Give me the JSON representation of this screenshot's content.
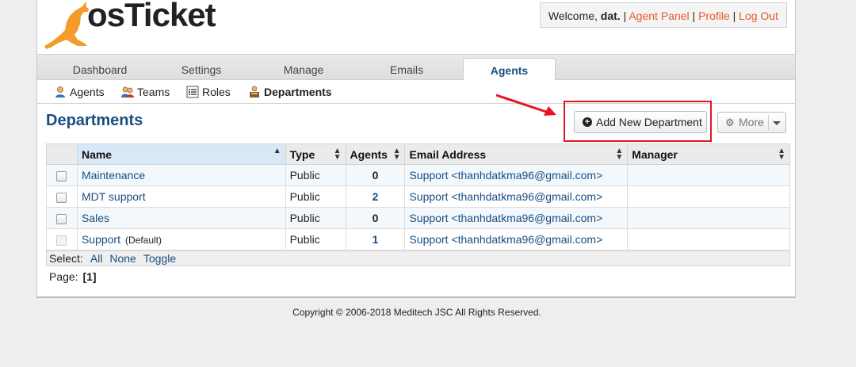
{
  "header": {
    "logo_text": "osTicket",
    "welcome": "Welcome,",
    "username": "dat.",
    "links": [
      "Agent Panel",
      "Profile",
      "Log Out"
    ]
  },
  "nav": {
    "tabs": [
      "Dashboard",
      "Settings",
      "Manage",
      "Emails",
      "Agents"
    ],
    "active": "Agents"
  },
  "subnav": {
    "items": [
      {
        "label": "Agents",
        "icon": "agent-icon"
      },
      {
        "label": "Teams",
        "icon": "teams-icon"
      },
      {
        "label": "Roles",
        "icon": "roles-icon"
      },
      {
        "label": "Departments",
        "icon": "departments-icon"
      }
    ],
    "active": "Departments"
  },
  "main": {
    "title": "Departments",
    "add_button": "Add New Department",
    "more_button": "More",
    "table": {
      "columns": [
        "Name",
        "Type",
        "Agents",
        "Email Address",
        "Manager"
      ],
      "rows": [
        {
          "name": "Maintenance",
          "default": "",
          "type": "Public",
          "agents": "0",
          "email": "Support <thanhdatkma96@gmail.com>",
          "manager": ""
        },
        {
          "name": "MDT support",
          "default": "",
          "type": "Public",
          "agents": "2",
          "email": "Support <thanhdatkma96@gmail.com>",
          "manager": ""
        },
        {
          "name": "Sales",
          "default": "",
          "type": "Public",
          "agents": "0",
          "email": "Support <thanhdatkma96@gmail.com>",
          "manager": ""
        },
        {
          "name": "Support",
          "default": "(Default)",
          "type": "Public",
          "agents": "1",
          "email": "Support <thanhdatkma96@gmail.com>",
          "manager": ""
        }
      ]
    },
    "select_label": "Select:",
    "select_links": [
      "All",
      "None",
      "Toggle"
    ],
    "page_label": "Page:",
    "page_current": "[1]"
  },
  "footer": {
    "copyright": "Copyright © 2006-2018 Meditech JSC All Rights Reserved."
  },
  "colors": {
    "accent_link": "#e7582c",
    "title_blue": "#184e81",
    "highlight_red": "#e8131f",
    "logo_orange": "#f39c2b"
  }
}
